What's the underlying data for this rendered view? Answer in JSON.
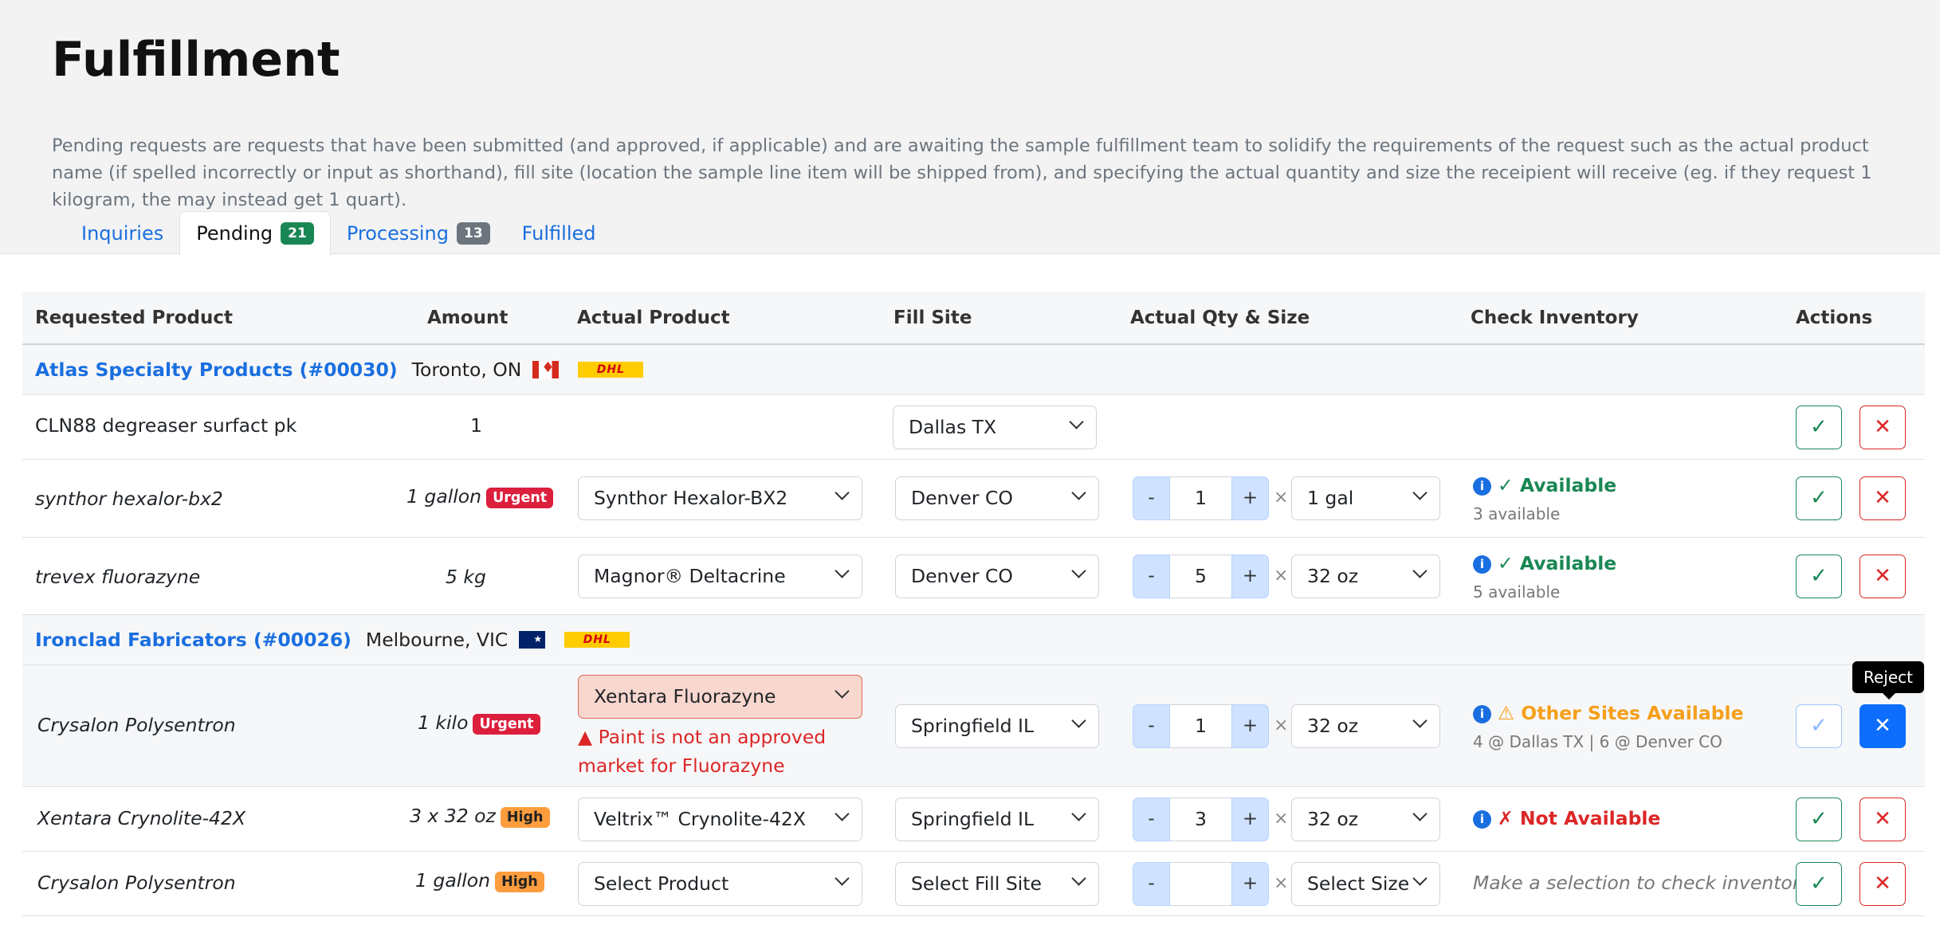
{
  "page": {
    "title": "Fulfillment",
    "description": "Pending requests are requests that have been submitted (and approved, if applicable) and are awaiting the sample fulfillment team to solidify the requirements of the request such as the actual product name (if spelled incorrectly or input as shorthand), fill site (location the sample line item will be shipped from), and specifying the actual quantity and size the receipient will receive (eg. if they request 1 kilogram, the may instead get 1 quart)."
  },
  "tabs": [
    {
      "label": "Inquiries",
      "count": ""
    },
    {
      "label": "Pending",
      "count": "21",
      "active": true
    },
    {
      "label": "Processing",
      "count": "13"
    },
    {
      "label": "Fulfilled",
      "count": ""
    }
  ],
  "columns": [
    "Requested Product",
    "Amount",
    "Actual Product",
    "Fill Site",
    "Actual Qty & Size",
    "Check Inventory",
    "Actions"
  ],
  "groups": [
    {
      "customer": "Atlas Specialty Products (#00030)",
      "location": "Toronto, ON",
      "carrier": "DHL",
      "rows": [
        {
          "requested": "CLN88 degreaser surfact pk",
          "amount": "1",
          "fill_site": "Dallas TX"
        },
        {
          "requested": "synthor hexalor-bx2",
          "amount": "1 gallon",
          "priority": "Urgent",
          "product": "Synthor Hexalor-BX2",
          "fill_site": "Denver CO",
          "qty": "1",
          "size": "1 gal",
          "inv_status": "✓ Available",
          "inv_detail": "3 available"
        },
        {
          "requested": "trevex fluorazyne",
          "amount": "5 kg",
          "product": "Magnor® Deltacrine",
          "fill_site": "Denver CO",
          "qty": "5",
          "size": "32 oz",
          "inv_status": "✓ Available",
          "inv_detail": "5 available"
        }
      ]
    },
    {
      "customer": "Ironclad Fabricators (#00026)",
      "location": "Melbourne, VIC",
      "carrier": "DHL",
      "rows": [
        {
          "requested": "Crysalon Polysentron",
          "amount": "1 kilo",
          "priority": "Urgent",
          "product": "Xentara Fluorazyne",
          "error": "Paint is not an approved market for Fluorazyne",
          "fill_site": "Springfield IL",
          "qty": "1",
          "size": "32 oz",
          "inv_status": "⚠ Other Sites Available",
          "inv_detail": "4 @ Dallas TX | 6 @ Denver CO"
        },
        {
          "requested": "Xentara Crynolite-42X",
          "amount": "3 x 32 oz",
          "priority": "High",
          "product": "Veltrix™ Crynolite-42X",
          "fill_site": "Springfield IL",
          "qty": "3",
          "size": "32 oz",
          "inv_status": "✗ Not Available"
        },
        {
          "requested": "Crysalon Polysentron",
          "amount": "1 gallon",
          "priority": "High",
          "product": "Select Product",
          "fill_site": "Select Fill Site",
          "qty": "",
          "size": "Select Size",
          "inv_hint": "Make a selection to check inventory"
        }
      ]
    }
  ],
  "stepper": {
    "minus": "-",
    "plus": "+",
    "times": "×"
  },
  "actions": {
    "accept": "✓",
    "reject": "✕",
    "reject_tooltip": "Reject"
  },
  "icons": {
    "info": "i",
    "error": "▲"
  },
  "colors": {
    "link": "#1a6fe0",
    "urgent": "#dc1f3c",
    "high": "#fd9d3e",
    "available": "#198754",
    "warning": "#f59f1a",
    "danger": "#dc2626"
  }
}
